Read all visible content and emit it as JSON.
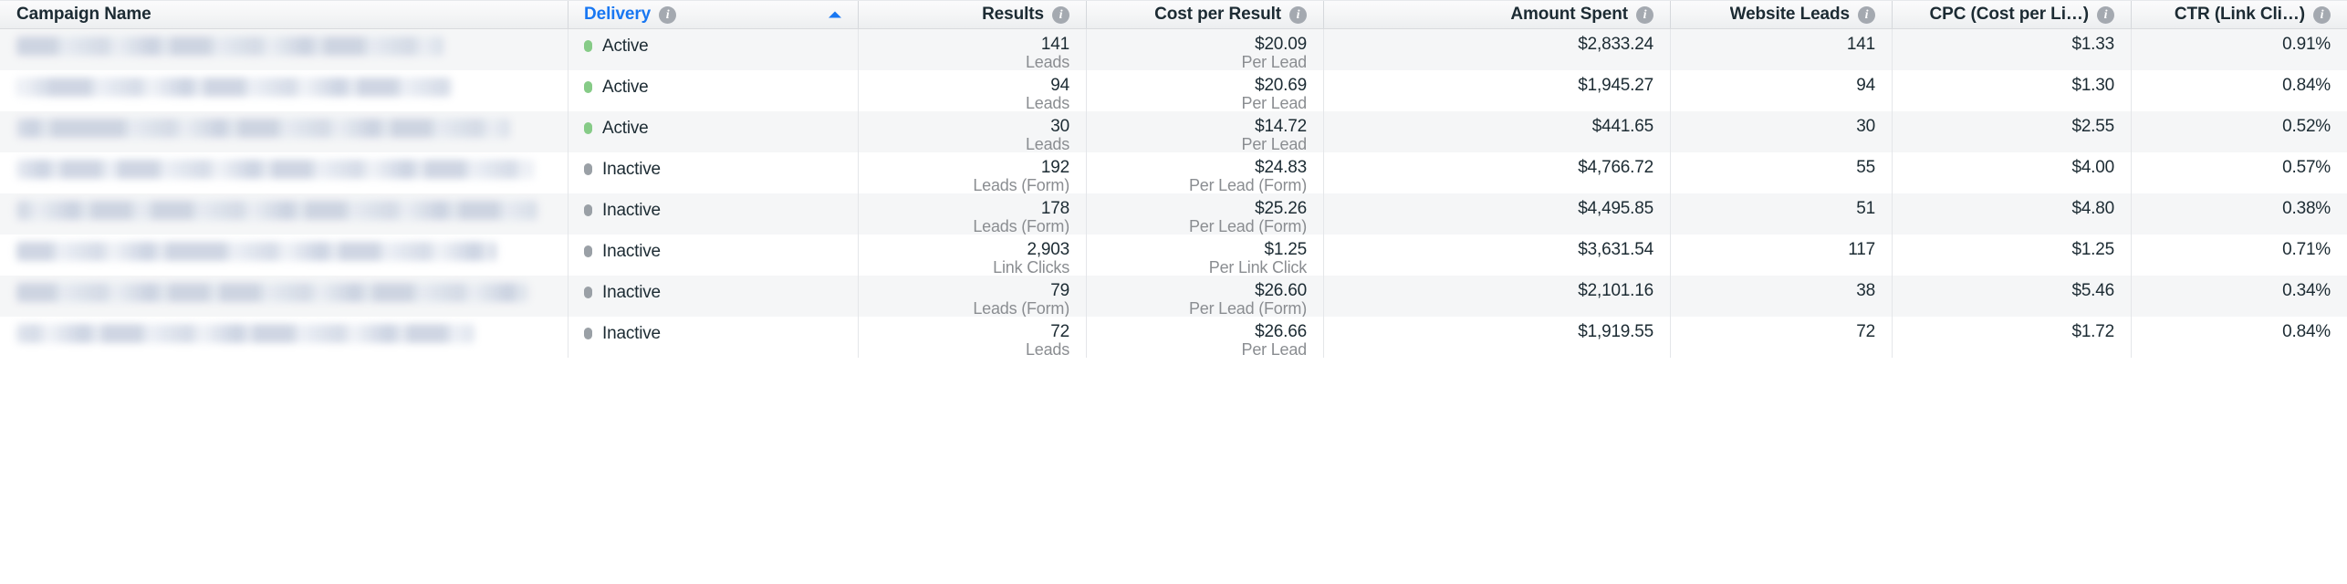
{
  "table": {
    "sort": {
      "column": "Delivery",
      "direction": "ascending",
      "indicator": "triangle-up"
    },
    "columns": [
      {
        "key": "campaign_name",
        "label": "Campaign Name",
        "align": "left",
        "info_icon": false,
        "sorted": false,
        "truncated": false
      },
      {
        "key": "delivery",
        "label": "Delivery",
        "align": "left",
        "info_icon": true,
        "sorted": true,
        "truncated": false
      },
      {
        "key": "results",
        "label": "Results",
        "align": "right",
        "info_icon": true,
        "sorted": false,
        "truncated": false
      },
      {
        "key": "cost_per_result",
        "label": "Cost per Result",
        "align": "right",
        "info_icon": true,
        "sorted": false,
        "truncated": false
      },
      {
        "key": "amount_spent",
        "label": "Amount Spent",
        "align": "right",
        "info_icon": true,
        "sorted": false,
        "truncated": false
      },
      {
        "key": "website_leads",
        "label": "Website Leads",
        "align": "right",
        "info_icon": true,
        "sorted": false,
        "truncated": false
      },
      {
        "key": "cpc",
        "label": "CPC (Cost per Li…)",
        "align": "right",
        "info_icon": true,
        "sorted": false,
        "truncated": true
      },
      {
        "key": "ctr",
        "label": "CTR (Link Cli…)",
        "align": "right",
        "info_icon": true,
        "sorted": false,
        "truncated": true
      }
    ],
    "info_icon_glyph": "i",
    "rows": [
      {
        "campaign_name": "",
        "campaign_name_redacted": true,
        "redaction_width": 468,
        "delivery": "Active",
        "delivery_status": "active",
        "results": "141",
        "results_unit": "Leads",
        "cost_per_result": "$20.09",
        "cost_per_result_unit": "Per Lead",
        "amount_spent": "$2,833.24",
        "website_leads": "141",
        "cpc": "$1.33",
        "ctr": "0.91%"
      },
      {
        "campaign_name": "",
        "campaign_name_redacted": true,
        "redaction_width": 477,
        "delivery": "Active",
        "delivery_status": "active",
        "results": "94",
        "results_unit": "Leads",
        "cost_per_result": "$20.69",
        "cost_per_result_unit": "Per Lead",
        "amount_spent": "$1,945.27",
        "website_leads": "94",
        "cpc": "$1.30",
        "ctr": "0.84%"
      },
      {
        "campaign_name": "",
        "campaign_name_redacted": true,
        "redaction_width": 541,
        "delivery": "Active",
        "delivery_status": "active",
        "results": "30",
        "results_unit": "Leads",
        "cost_per_result": "$14.72",
        "cost_per_result_unit": "Per Lead",
        "amount_spent": "$441.65",
        "website_leads": "30",
        "cpc": "$2.55",
        "ctr": "0.52%"
      },
      {
        "campaign_name": "",
        "campaign_name_redacted": true,
        "redaction_width": 567,
        "delivery": "Inactive",
        "delivery_status": "inactive",
        "results": "192",
        "results_unit": "Leads (Form)",
        "cost_per_result": "$24.83",
        "cost_per_result_unit": "Per Lead (Form)",
        "amount_spent": "$4,766.72",
        "website_leads": "55",
        "cpc": "$4.00",
        "ctr": "0.57%"
      },
      {
        "campaign_name": "",
        "campaign_name_redacted": true,
        "redaction_width": 571,
        "delivery": "Inactive",
        "delivery_status": "inactive",
        "results": "178",
        "results_unit": "Leads (Form)",
        "cost_per_result": "$25.26",
        "cost_per_result_unit": "Per Lead (Form)",
        "amount_spent": "$4,495.85",
        "website_leads": "51",
        "cpc": "$4.80",
        "ctr": "0.38%"
      },
      {
        "campaign_name": "",
        "campaign_name_redacted": true,
        "redaction_width": 526,
        "delivery": "Inactive",
        "delivery_status": "inactive",
        "results": "2,903",
        "results_unit": "Link Clicks",
        "cost_per_result": "$1.25",
        "cost_per_result_unit": "Per Link Click",
        "amount_spent": "$3,631.54",
        "website_leads": "117",
        "cpc": "$1.25",
        "ctr": "0.71%"
      },
      {
        "campaign_name": "",
        "campaign_name_redacted": true,
        "redaction_width": 560,
        "delivery": "Inactive",
        "delivery_status": "inactive",
        "results": "79",
        "results_unit": "Leads (Form)",
        "cost_per_result": "$26.60",
        "cost_per_result_unit": "Per Lead (Form)",
        "amount_spent": "$2,101.16",
        "website_leads": "38",
        "cpc": "$5.46",
        "ctr": "0.34%"
      },
      {
        "campaign_name": "",
        "campaign_name_redacted": true,
        "redaction_width": 502,
        "delivery": "Inactive",
        "delivery_status": "inactive",
        "results": "72",
        "results_unit": "Leads",
        "cost_per_result": "$26.66",
        "cost_per_result_unit": "Per Lead",
        "amount_spent": "$1,919.55",
        "website_leads": "72",
        "cpc": "$1.72",
        "ctr": "0.84%"
      }
    ]
  },
  "colors": {
    "sorted_header": "#1877f2",
    "status_active": "#86cb87",
    "status_inactive": "#9aa0a6",
    "text_primary": "#1c2b33",
    "text_secondary": "#8a8d91",
    "row_alt_background": "#f5f6f7",
    "header_background": "#f4f5f6",
    "info_icon": "#a4a9b0"
  }
}
